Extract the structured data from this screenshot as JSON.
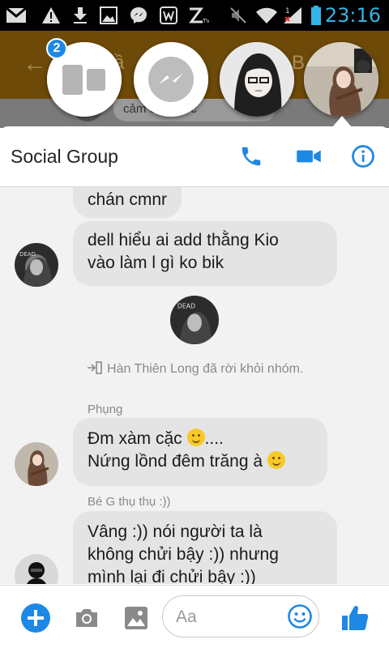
{
  "status_bar": {
    "time": "23:16",
    "icons": [
      "gmail-icon",
      "alert-icon",
      "download-icon",
      "image-icon",
      "messenger-icon",
      "notification-icon",
      "zing-icon",
      "mute-icon",
      "wifi-icon",
      "signal-icon",
      "battery-icon"
    ]
  },
  "background_chat": {
    "title_fragment": "ầ",
    "title_fragment_2": "B",
    "visible_message": "cảm ơn khó c"
  },
  "chat_heads": {
    "badge_count": "2",
    "items": [
      "group-chat-head",
      "messenger-chat-head",
      "anime-avatar-head",
      "violin-avatar-head"
    ]
  },
  "conversation": {
    "title": "Social Group",
    "messages": [
      {
        "text": "chán cmnr"
      },
      {
        "text_lines": [
          "dell hiểu ai add thằng Kio",
          "vào làm l gì ko bik"
        ]
      },
      {
        "notice": "Hàn Thiên Long đã rời khỏi nhóm."
      },
      {
        "sender": "Phụng",
        "line1_text": "Đm xàm cặc",
        "line1_suffix": "....",
        "line2_text": "Nứng lồnd đêm trăng à"
      },
      {
        "sender": "Bé G thụ thụ :))",
        "text_lines": [
          "Vâng :)) nói người ta là",
          "không chửi bậy :)) nhưng",
          "mình lại đi chửi bậy :))"
        ]
      }
    ]
  },
  "composer": {
    "placeholder": "Aa"
  },
  "colors": {
    "accent": "#1e88e5",
    "bubble": "#e4e4e4",
    "status_time": "#33b5e5"
  }
}
